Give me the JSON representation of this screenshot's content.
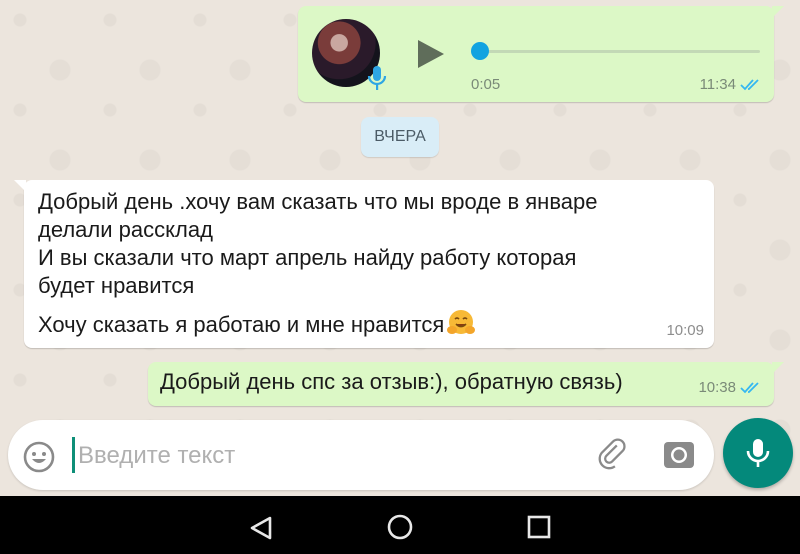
{
  "voice_message": {
    "duration": "0:05",
    "time": "11:34",
    "read_status": "read",
    "tick_color": "#34b7f1"
  },
  "date_chip": {
    "label": "ВЧЕРА"
  },
  "incoming_message": {
    "lines": [
      "Добрый день .хочу вам сказать что мы вроде в январе",
      "делали рассклад",
      "И вы сказали что март апрель найду работу которая",
      "будет нравится",
      "Хочу сказать я работаю и мне нравится"
    ],
    "emoji": "hugging-face",
    "time": "10:09"
  },
  "outgoing_message": {
    "text": "Добрый день спс за отзыв:), обратную связь)",
    "time": "10:38",
    "read_status": "read"
  },
  "composer": {
    "placeholder": "Введите текст",
    "value": ""
  },
  "colors": {
    "outgoing_bubble": "#dcf8c6",
    "incoming_bubble": "#ffffff",
    "accent": "#04897b",
    "voice_progress": "#12a3e0"
  },
  "nav_bar": {
    "icons": [
      "back-icon",
      "home-icon",
      "recents-icon"
    ]
  }
}
